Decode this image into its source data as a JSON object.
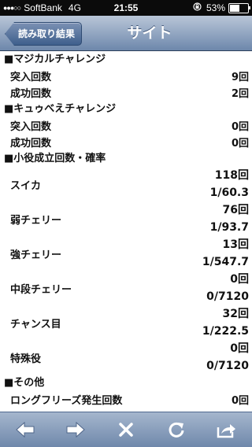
{
  "status": {
    "carrier": "SoftBank",
    "network": "4G",
    "time": "21:55",
    "battery": "53%",
    "battery_level": 0.53
  },
  "nav": {
    "back_label": "読み取り結果",
    "title": "サイト"
  },
  "sections": [
    {
      "header": "■マジカルチャレンジ",
      "rows": [
        {
          "label": "突入回数",
          "value": "9回"
        },
        {
          "label": "成功回数",
          "value": "2回"
        }
      ]
    },
    {
      "header": "■キュゥべえチャレンジ",
      "rows": [
        {
          "label": "突入回数",
          "value": "0回"
        },
        {
          "label": "成功回数",
          "value": "0回"
        }
      ]
    },
    {
      "header": "■小役成立回数・確率",
      "rows": [
        {
          "label": "スイカ",
          "count": "118回",
          "prob": "1/60.3"
        },
        {
          "label": "弱チェリー",
          "count": "76回",
          "prob": "1/93.7"
        },
        {
          "label": "強チェリー",
          "count": "13回",
          "prob": "1/547.7"
        },
        {
          "label": "中段チェリー",
          "count": "0回",
          "prob": "0/7120"
        },
        {
          "label": "チャンス目",
          "count": "32回",
          "prob": "1/222.5"
        },
        {
          "label": "特殊役",
          "count": "0回",
          "prob": "0/7120"
        }
      ]
    },
    {
      "header": "■その他",
      "rows": [
        {
          "label": "ロングフリーズ発生回数",
          "value": "0回"
        }
      ]
    }
  ],
  "toolbar": {
    "icons": [
      "back-arrow-icon",
      "forward-arrow-icon",
      "close-icon",
      "reload-icon",
      "share-icon"
    ]
  }
}
